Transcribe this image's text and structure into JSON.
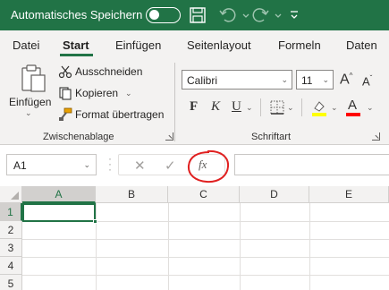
{
  "titlebar": {
    "autosave_label": "Automatisches Speichern",
    "autosave_state": "off",
    "icons": [
      "save-icon",
      "undo-icon",
      "redo-icon",
      "customize-qat-icon"
    ]
  },
  "tabs": [
    "Datei",
    "Start",
    "Einfügen",
    "Seitenlayout",
    "Formeln",
    "Daten"
  ],
  "active_tab": "Start",
  "clipboard": {
    "paste_label": "Einfügen",
    "cut_label": "Ausschneiden",
    "copy_label": "Kopieren",
    "format_painter_label": "Format übertragen",
    "group_label": "Zwischenablage"
  },
  "font": {
    "font_name": "Calibri",
    "font_size": "11",
    "bold": "F",
    "italic": "K",
    "underline": "U",
    "font_color_letter": "A",
    "group_label": "Schriftart",
    "highlight_color": "#ffff00",
    "font_color": "#ff0000"
  },
  "formula_bar": {
    "name_box": "A1",
    "fx_label": "fx",
    "formula": ""
  },
  "sheet": {
    "columns": [
      "A",
      "B",
      "C",
      "D",
      "E"
    ],
    "rows": [
      "1",
      "2",
      "3",
      "4",
      "5"
    ],
    "selected_cell": "A1"
  },
  "colors": {
    "accent": "#217346",
    "annotation": "#e02020"
  }
}
